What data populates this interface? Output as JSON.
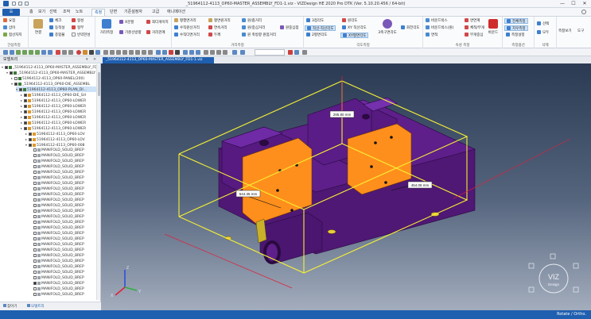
{
  "window": {
    "title": "_51964112-4113_OP60-MASTER_ASSEMBLY_FD1-1.viz - VIZDesign HE 2020 Pro DTK (Ver. 5.10.20.456 / 64-bit)",
    "minimize": "—",
    "maximize": "☐",
    "close": "✕"
  },
  "menu": {
    "file_tab": "☰",
    "tabs": [
      "홈",
      "보기",
      "선택",
      "조작",
      "노트",
      "측정",
      "단면",
      "기준설정자",
      "고급",
      "애니메이션"
    ],
    "active_tab": "측정"
  },
  "ribbon": {
    "groups": [
      {
        "label": "간섭측정",
        "items": [
          "요점",
          "삽이",
          "접선자지"
        ]
      },
      {
        "label": "",
        "items": [
          "체크",
          "동적설",
          "종합불",
          "형성",
          "형부",
          "빈약한성"
        ],
        "big": "연결"
      },
      {
        "label": "",
        "items": [
          "최다게이지",
          "거리관계",
          "기준선방향"
        ],
        "bigs": [
          "거리측정",
          "X분할"
        ]
      },
      {
        "label": "거리측정",
        "items": [
          "평행면거리",
          "수직원선거리",
          "수직다면거리",
          "평면원거리",
          "연속거리",
          "두께",
          "원/좁거리",
          "원/중심거리",
          "원 축방향 원점거리",
          "원중심점"
        ]
      },
      {
        "label": "각도측정",
        "items": [
          "3점각도",
          "직선-직선각도",
          "2평면각도",
          "원각도",
          "XY 직선각도",
          "XY평면각도"
        ],
        "big": "3축구면각도",
        "small": "회전각도"
      },
      {
        "label": "속성 측정",
        "items": [
          "바운드박스",
          "바운드박스(원)",
          "면적",
          "면연계",
          "체적/무게",
          "무게중심"
        ],
        "big": "바운드"
      },
      {
        "label": "측정옵션",
        "items": [
          "전체측정",
          "치우측정",
          "측정설정"
        ]
      },
      {
        "label": "삭제",
        "items": [
          "선택",
          "모두"
        ]
      },
      {
        "label": "",
        "items": [
          "측정보기",
          "도구"
        ]
      }
    ]
  },
  "toolbar": {
    "search_value": ""
  },
  "document_tab": {
    "label": "_51964112-4113_OP60-MASTER_ASSEMBLY_FD1-1.viz"
  },
  "model_tree": {
    "title": "모델트리",
    "controls": [
      "▾",
      "✕"
    ],
    "rows": [
      {
        "label": "_51964112-4113_OP60-MASTER_ASSEMBLY_FD1-1.viz",
        "indent": 0,
        "checked": true,
        "expanded": true
      },
      {
        "label": "_51964112-4113_OP60-MASTER_ASSEMBLY",
        "indent": 1,
        "checked": true,
        "expanded": true
      },
      {
        "label": "51964112-4113_OP60-PANEL(200)",
        "indent": 2,
        "checked": false,
        "expanded": false
      },
      {
        "label": "_51964112-4113_OP60-DIE_ASSEMBL",
        "indent": 2,
        "checked": true,
        "expanded": true
      },
      {
        "label": "51964112-4113_OP60-PLAN_DI...",
        "indent": 3,
        "checked": true,
        "expanded": true,
        "selected": true
      },
      {
        "label": "51964112-4113_OP60-DIE_SH",
        "indent": 4,
        "checked": true,
        "expanded": false
      },
      {
        "label": "51964112-4113_OP60-LOWER",
        "indent": 4,
        "checked": true,
        "expanded": false
      },
      {
        "label": "51964112-4113_OP60-LOWER",
        "indent": 4,
        "checked": true,
        "expanded": false
      },
      {
        "label": "51964112-4113_OP60-LOWER",
        "indent": 4,
        "checked": true,
        "expanded": false
      },
      {
        "label": "51964112-4113_OP60-LOWER",
        "indent": 4,
        "checked": true,
        "expanded": false
      },
      {
        "label": "51964112-4113_OP60-LOWER",
        "indent": 4,
        "checked": true,
        "expanded": false
      },
      {
        "label": "51964112-4113_OP60-LOWER",
        "indent": 4,
        "checked": true,
        "expanded": false
      },
      {
        "label": "51964112-4113_OP60-LOV",
        "indent": 5,
        "checked": true,
        "expanded": false
      },
      {
        "label": "51964112-4113_OP60-LOV",
        "indent": 5,
        "checked": true,
        "expanded": false
      },
      {
        "label": "51964112-4113_OP60-008",
        "indent": 5,
        "checked": true,
        "expanded": true
      },
      {
        "label": "MANIFOLD_SOLID_BREP",
        "indent": 6,
        "checked": false
      },
      {
        "label": "MANIFOLD_SOLID_BREP",
        "indent": 6,
        "checked": false
      },
      {
        "label": "MANIFOLD_SOLID_BREP",
        "indent": 6,
        "checked": false
      },
      {
        "label": "MANIFOLD_SOLID_BREP",
        "indent": 6,
        "checked": false
      },
      {
        "label": "MANIFOLD_SOLID_BREP",
        "indent": 6,
        "checked": false
      },
      {
        "label": "MANIFOLD_SOLID_BREP",
        "indent": 6,
        "checked": false
      },
      {
        "label": "MANIFOLD_SOLID_BREP",
        "indent": 6,
        "checked": false
      },
      {
        "label": "MANIFOLD_SOLID_BREP",
        "indent": 6,
        "checked": false
      },
      {
        "label": "MANIFOLD_SOLID_BREP",
        "indent": 6,
        "checked": false
      },
      {
        "label": "MANIFOLD_SOLID_BREP",
        "indent": 6,
        "checked": false
      },
      {
        "label": "MANIFOLD_SOLID_BREP",
        "indent": 6,
        "checked": false
      },
      {
        "label": "MANIFOLD_SOLID_BREP",
        "indent": 6,
        "checked": false
      },
      {
        "label": "MANIFOLD_SOLID_BREP",
        "indent": 6,
        "checked": false
      },
      {
        "label": "MANIFOLD_SOLID_BREP",
        "indent": 6,
        "checked": false
      },
      {
        "label": "MANIFOLD_SOLID_BREP",
        "indent": 6,
        "checked": false
      },
      {
        "label": "MANIFOLD_SOLID_BREP",
        "indent": 6,
        "checked": false
      },
      {
        "label": "MANIFOLD_SOLID_BREP",
        "indent": 6,
        "checked": false
      },
      {
        "label": "MANIFOLD_SOLID_BREP",
        "indent": 6,
        "checked": false
      },
      {
        "label": "MANIFOLD_SOLID_BREP",
        "indent": 6,
        "checked": false
      },
      {
        "label": "MANIFOLD_SOLID_BREP",
        "indent": 6,
        "checked": false
      },
      {
        "label": "MANIFOLD_SOLID_BREP",
        "indent": 6,
        "checked": false
      },
      {
        "label": "MANIFOLD_SOLID_BREP",
        "indent": 6,
        "checked": false
      },
      {
        "label": "MANIFOLD_SOLID_BREP",
        "indent": 6,
        "checked": false
      },
      {
        "label": "MANIFOLD_SOLID_BREP",
        "indent": 6,
        "checked": false
      },
      {
        "label": "MANIFOLD_SOLID_BREP",
        "indent": 6,
        "checked": true
      },
      {
        "label": "MANIFOLD_SOLID_BREP",
        "indent": 6,
        "checked": false
      },
      {
        "label": "MANIFOLD_SOLID_BREP",
        "indent": 6,
        "checked": false
      }
    ],
    "footer_tabs": [
      "찾아기",
      "모델트리"
    ]
  },
  "viewport": {
    "measure_labels": [
      "295.80 mm",
      "544.35 mm",
      "454.06 mm"
    ],
    "axis_labels": [
      "Z",
      "X",
      "Y"
    ],
    "logo_text": "VIZ",
    "logo_sub": "Design"
  },
  "status": {
    "mode": "Rotate / Ortho."
  },
  "colors": {
    "accent": "#1f5fb0",
    "part_purple": "#5c1a86",
    "part_orange": "#ff8f1c",
    "bbox_yellow": "#f6f034",
    "measure_red": "#e0203a"
  }
}
